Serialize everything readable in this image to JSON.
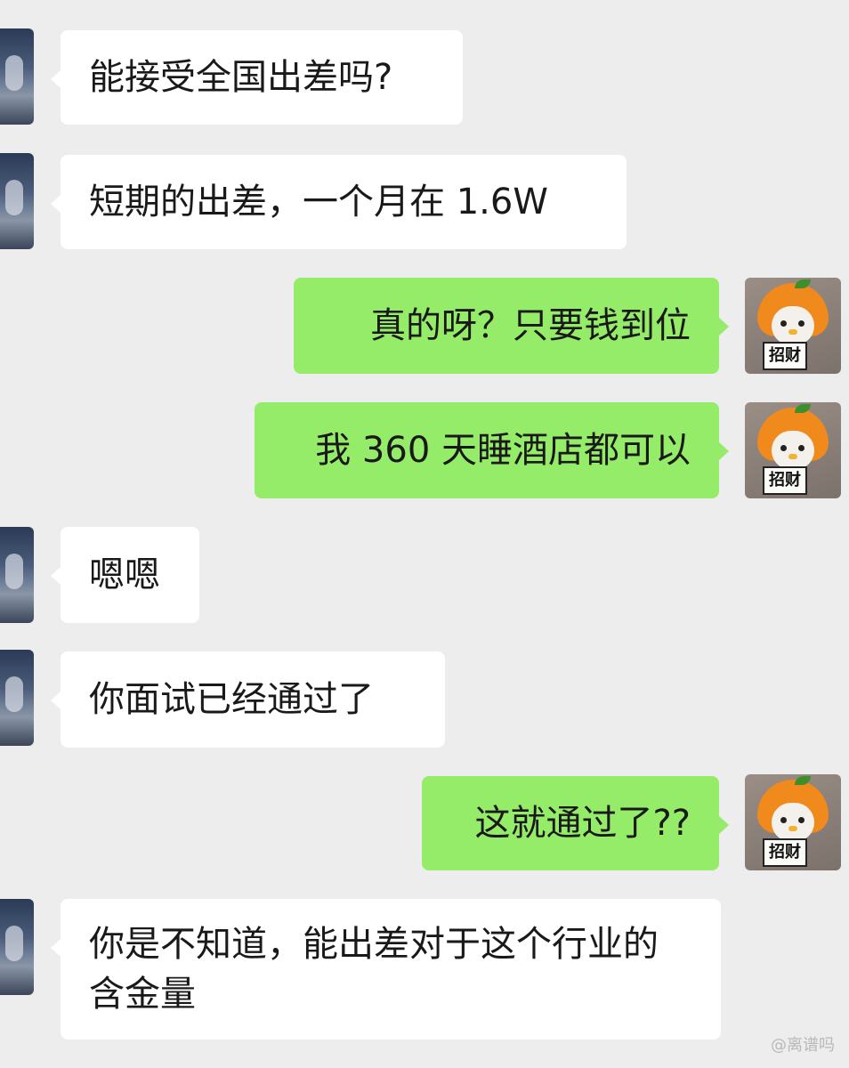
{
  "chat": {
    "messages": [
      {
        "sender": "other",
        "text": "能接受全国出差吗?"
      },
      {
        "sender": "other",
        "text": "短期的出差，一个月在 1.6W"
      },
      {
        "sender": "self",
        "text": "真的呀？只要钱到位"
      },
      {
        "sender": "self",
        "text": "我 360 天睡酒店都可以"
      },
      {
        "sender": "other",
        "text": "嗯嗯"
      },
      {
        "sender": "other",
        "text": "你面试已经通过了"
      },
      {
        "sender": "self",
        "text": "这就通过了??"
      },
      {
        "sender": "other",
        "text": "你是不知道，能出差对于这个行业的含金量"
      }
    ],
    "self_avatar_sign": "招财",
    "watermark": "@离谱吗"
  },
  "colors": {
    "background": "#ededed",
    "incoming_bubble": "#ffffff",
    "outgoing_bubble": "#95ec69",
    "text": "#191919"
  },
  "icons": {
    "incoming_avatar": "contact-avatar-icon",
    "outgoing_avatar": "penguin-avatar-icon"
  }
}
